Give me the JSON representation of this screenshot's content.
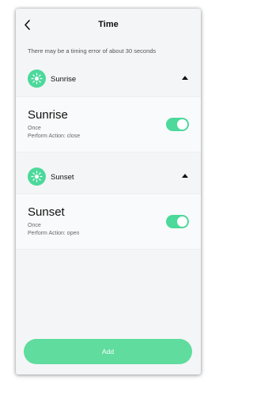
{
  "header": {
    "title": "Time"
  },
  "notice": "There may be a timing error of about 30 seconds",
  "sections": [
    {
      "label": "Sunrise",
      "card": {
        "title": "Sunrise",
        "repeat": "Once",
        "action": "Perform Action: close",
        "enabled": true
      }
    },
    {
      "label": "Sunset",
      "card": {
        "title": "Sunset",
        "repeat": "Once",
        "action": "Perform Action: open",
        "enabled": true
      }
    }
  ],
  "add_button": "Add",
  "colors": {
    "accent": "#4cd99b",
    "button": "#5fdc9e",
    "background": "#f4f5f7"
  },
  "icons": {
    "back": "chevron-left-icon",
    "sun": "sun-icon",
    "collapse": "caret-up-icon"
  }
}
